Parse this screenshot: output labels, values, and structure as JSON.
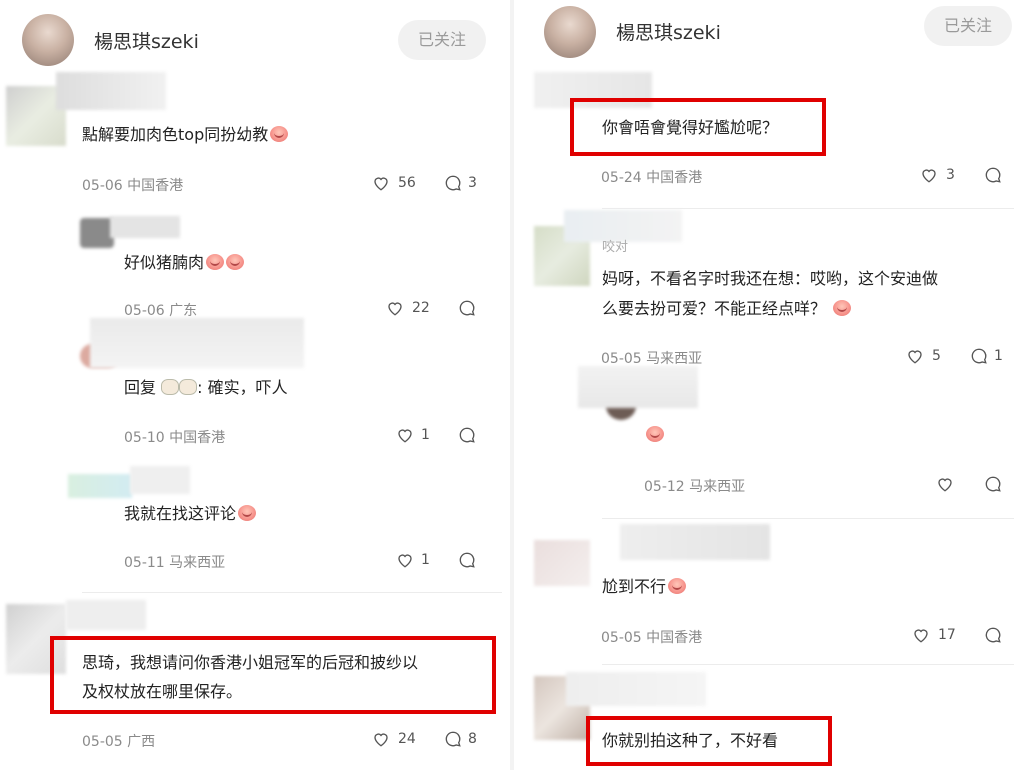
{
  "left": {
    "header": {
      "username": "楊思琪szeki",
      "follow_label": "已关注"
    },
    "comments": [
      {
        "text": "點解要加肉色top同扮幼教",
        "date": "05-06",
        "location": "中国香港",
        "likes": "56",
        "replies": "3"
      },
      {
        "text": "好似猪腩肉",
        "date": "05-06",
        "location": "广东",
        "likes": "22",
        "replies": ""
      },
      {
        "text_prefix": "回复",
        "text_suffix": ": 確实，吓人",
        "date": "05-10",
        "location": "中国香港",
        "likes": "1",
        "replies": ""
      },
      {
        "text": "我就在找这评论",
        "date": "05-11",
        "location": "马来西亚",
        "likes": "1",
        "replies": ""
      },
      {
        "line1": "思琦，我想请问你香港小姐冠军的后冠和披纱以",
        "line2": "及权杖放在哪里保存。",
        "date": "05-05",
        "location": "广西",
        "likes": "24",
        "replies": "8"
      }
    ]
  },
  "right": {
    "header": {
      "username": "楊思琪szeki",
      "follow_label": "已关注"
    },
    "comments": [
      {
        "text": "你會唔會覺得好尷尬呢？",
        "date": "05-24",
        "location": "中国香港",
        "likes": "3",
        "replies": ""
      },
      {
        "author_fragment": "咬对",
        "line1": "妈呀，不看名字时我还在想：哎哟，这个安迪做",
        "line2": "么要去扮可爱？不能正经点咩？",
        "date": "05-05",
        "location": "马来西亚",
        "likes": "5",
        "replies": "1"
      },
      {
        "date": "05-12",
        "location": "马来西亚",
        "likes": "",
        "replies": ""
      },
      {
        "text": "尬到不行",
        "date": "05-05",
        "location": "中国香港",
        "likes": "17",
        "replies": ""
      },
      {
        "text": "你就别拍这种了，不好看"
      }
    ]
  },
  "icons": {
    "like": "heart-icon",
    "reply": "speech-bubble-icon",
    "emoji": "crying-laughing-emoji",
    "emoji_alt": "rabbit-emoji"
  },
  "colors": {
    "highlight": "#e00000",
    "muted": "#8a8a8a",
    "follow_bg": "#f1f1f1"
  }
}
